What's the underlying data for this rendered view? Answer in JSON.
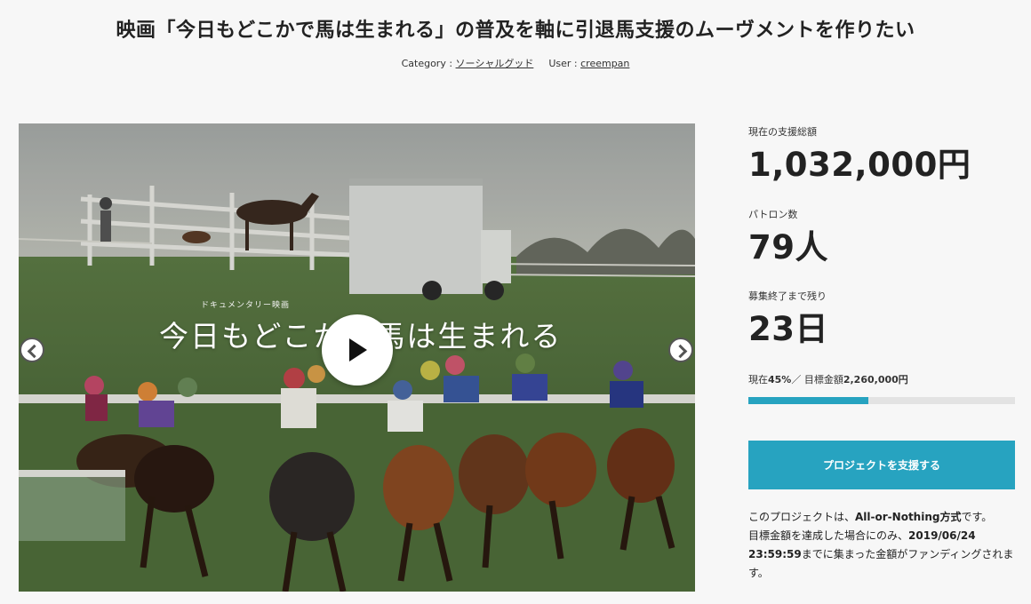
{
  "title": "映画「今日もどこかで馬は生まれる」の普及を軸に引退馬支援のムーヴメントを作りたい",
  "meta": {
    "category_label": "Category :",
    "category": "ソーシャルグッド",
    "user_label": "User :",
    "user": "creempan"
  },
  "media": {
    "overlay_subtitle": "ドキュメンタリー映画",
    "overlay_title": "今日もどこかで馬は生まれる",
    "play_icon": "play-icon",
    "prev_icon": "chevron-left-icon",
    "next_icon": "chevron-right-icon"
  },
  "stats": {
    "amount_label": "現在の支援総額",
    "amount": "1,032,000円",
    "patrons_label": "パトロン数",
    "patrons": "79人",
    "remaining_label": "募集終了まで残り",
    "remaining": "23日"
  },
  "goal": {
    "prefix": "現在",
    "percent_text": "45%",
    "separator": "／ 目標金額",
    "target": "2,260,000円",
    "progress": 0.45
  },
  "cta_label": "プロジェクトを支援する",
  "note": {
    "line1_prefix": "このプロジェクトは、",
    "line1_bold": "All-or-Nothing方式",
    "line1_suffix": "です。",
    "line2_prefix": "目標金額を達成した場合にのみ、",
    "line2_bold": "2019/06/24 23:59:59",
    "line2_suffix": "までに集まった金額がファンディングされます。"
  },
  "colors": {
    "accent": "#27a3c0",
    "progress_track": "#e3e3e3",
    "background": "#f7f7f7"
  }
}
